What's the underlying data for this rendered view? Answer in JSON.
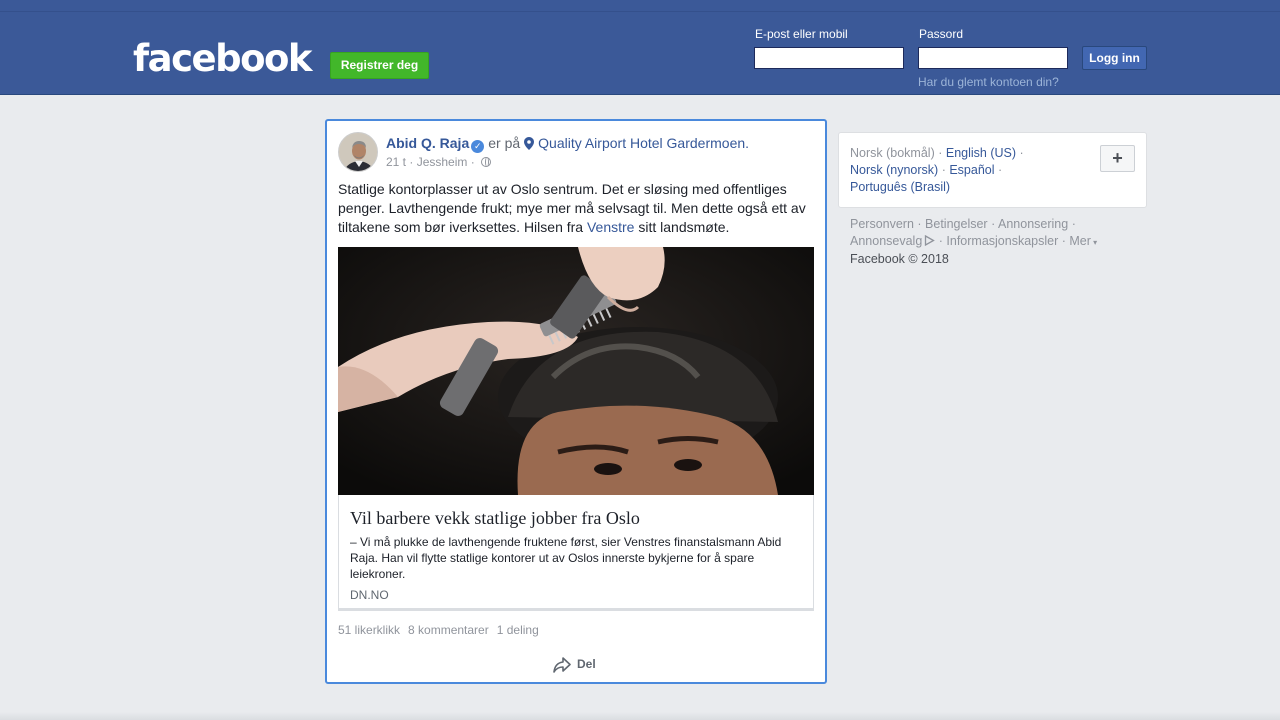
{
  "header": {
    "logo": "facebook",
    "register_label": "Registrer deg",
    "email_label": "E-post eller mobil",
    "email_value": "",
    "password_label": "Passord",
    "password_value": "",
    "login_label": "Logg inn",
    "forgot_label": "Har du glemt kontoen din?"
  },
  "post": {
    "author": "Abid Q. Raja",
    "verified_icon": "✓",
    "is_at": "er på",
    "place": "Quality Airport Hotel Gardermoen.",
    "time": "21 t",
    "location": "Jessheim",
    "text_before": "Statlige kontorplasser ut av Oslo sentrum. Det er sløsing med offentliges penger. Lavthengende frukt; mye mer må selvsagt til. Men dette også ett av tiltakene som bør iverksettes. Hilsen fra ",
    "text_link": "Venstre",
    "text_after": " sitt landsmøte.",
    "link_title": "Vil barbere vekk statlige jobber fra Oslo",
    "link_description": "– Vi må plukke de lavthengende fruktene først, sier Venstres finanstalsmann Abid Raja. Han vil flytte statlige kontorer ut av Oslos innerste bykjerne for å spare leiekroner.",
    "link_domain": "DN.NO",
    "likes": "51 likerklikk",
    "comments": "8 kommentarer",
    "shares": "1 deling",
    "share_label": "Del"
  },
  "sidebar": {
    "lang_current": "Norsk (bokmål)",
    "lang_en": "English (US)",
    "lang_nn": "Norsk (nynorsk)",
    "lang_es": "Español",
    "lang_pt": "Português (Brasil)",
    "plus": "+",
    "privacy": "Personvern",
    "terms": "Betingelser",
    "advertising": "Annonsering",
    "ad_choices": "Annonsevalg",
    "cookies": "Informasjonskapsler",
    "more": "Mer",
    "copyright": "Facebook © 2018"
  },
  "colors": {
    "brand": "#3b5998",
    "register": "#42b72a",
    "link": "#365899",
    "highlight_border": "#4a89dc"
  }
}
